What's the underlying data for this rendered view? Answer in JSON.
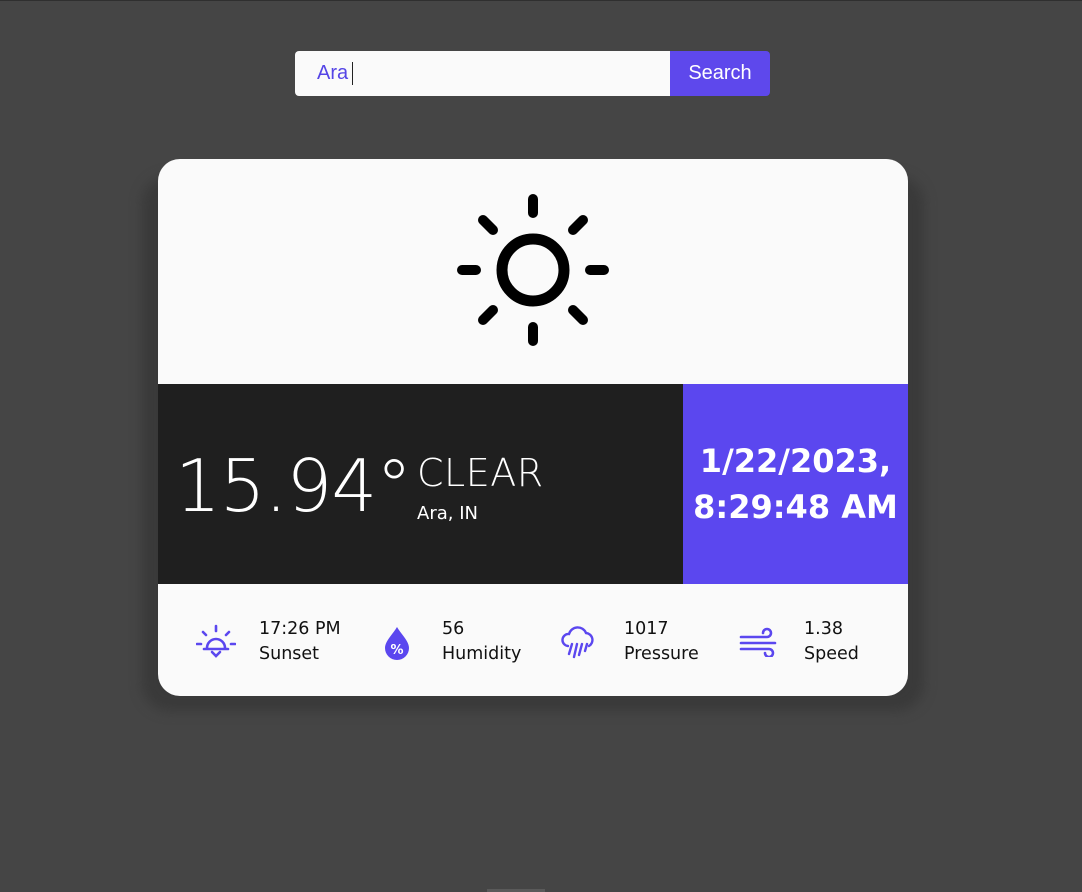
{
  "search": {
    "value": "Ara",
    "button_label": "Search"
  },
  "weather": {
    "temperature": "15.94°",
    "condition": "CLEAR",
    "location": "Ara, IN",
    "date": "1/22/2023,",
    "time": "8:29:48 AM"
  },
  "stats": [
    {
      "icon": "sunset-icon",
      "value": "17:26 PM",
      "label": "Sunset"
    },
    {
      "icon": "humidity-icon",
      "value": "56",
      "label": "Humidity"
    },
    {
      "icon": "rain-cloud-icon",
      "value": "1017",
      "label": "Pressure"
    },
    {
      "icon": "wind-icon",
      "value": "1.38",
      "label": "Speed"
    }
  ],
  "colors": {
    "accent": "#5b47ef",
    "background": "#454545",
    "dark_panel": "#1f1f1f",
    "card": "#fafafa"
  }
}
